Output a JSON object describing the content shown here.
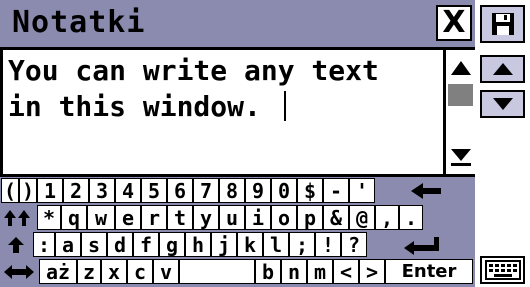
{
  "window": {
    "title": "Notatki",
    "close_glyph": "X"
  },
  "editor": {
    "text": "You can write any text\nin this window. "
  },
  "keyboard": {
    "row1": [
      "(",
      ")",
      "1",
      "2",
      "3",
      "4",
      "5",
      "6",
      "7",
      "8",
      "9",
      "0",
      "$",
      "-",
      "'"
    ],
    "row2": [
      "*",
      "q",
      "w",
      "e",
      "r",
      "t",
      "y",
      "u",
      "i",
      "o",
      "p",
      "&",
      "@",
      ",",
      "."
    ],
    "row3": [
      ":",
      "a",
      "s",
      "d",
      "f",
      "g",
      "h",
      "j",
      "k",
      "l",
      ";",
      "!",
      "?"
    ],
    "row4_left": [
      "aż",
      "z",
      "x",
      "c",
      "v"
    ],
    "row4_right": [
      "b",
      "n",
      "m",
      "<",
      ">"
    ],
    "enter_label": "Enter"
  },
  "icons": {
    "close": "close-icon",
    "save": "floppy-disk-icon",
    "page_up": "triangle-up-icon",
    "page_down": "triangle-down-icon",
    "backspace": "arrow-left-icon",
    "caps_lock": "double-up-arrow-icon",
    "shift": "up-arrow-icon",
    "return": "return-arrow-icon",
    "switch_layout": "left-right-arrow-icon",
    "keyboard": "keyboard-icon"
  },
  "colors": {
    "chrome": "#8b8bb0",
    "button_face": "#c8c8e0",
    "scroll_thumb": "#808080"
  }
}
